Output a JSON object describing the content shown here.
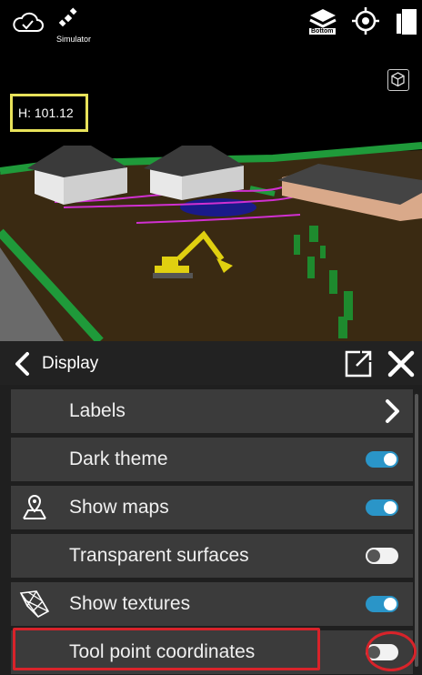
{
  "topbar": {
    "simulator_label": "Simulator",
    "bottom_badge": "Bottom",
    "icons": [
      "cloud-check-icon",
      "satellite-icon",
      "layers-icon",
      "target-icon",
      "panels-icon"
    ]
  },
  "viewport": {
    "height_readout": "H: 101.12"
  },
  "panel": {
    "title": "Display",
    "rows": [
      {
        "label": "Labels",
        "control": "chevron"
      },
      {
        "label": "Dark theme",
        "control": "toggle",
        "on": true
      },
      {
        "label": "Show maps",
        "control": "toggle",
        "on": true,
        "icon": "map-pin-icon"
      },
      {
        "label": "Transparent surfaces",
        "control": "toggle",
        "on": false
      },
      {
        "label": "Show textures",
        "control": "toggle",
        "on": true,
        "icon": "texture-mesh-icon"
      },
      {
        "label": "Tool point coordinates",
        "control": "toggle",
        "on": false
      }
    ]
  },
  "colors": {
    "accent": "#2a95c8",
    "highlight": "#d8232a",
    "readout_border": "#e8e25a"
  }
}
